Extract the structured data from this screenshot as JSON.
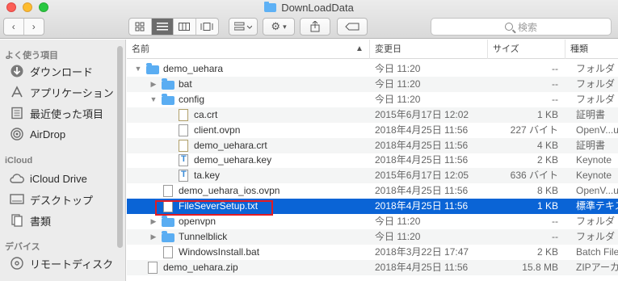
{
  "window": {
    "title": "DownLoadData"
  },
  "toolbar": {
    "back": "‹",
    "forward": "›",
    "search_placeholder": "検索"
  },
  "sidebar": {
    "favorites_header": "よく使う項目",
    "favorites": [
      {
        "label": "ダウンロード",
        "icon": "download-icon"
      },
      {
        "label": "アプリケーション",
        "icon": "applications-icon"
      },
      {
        "label": "最近使った項目",
        "icon": "recents-icon"
      },
      {
        "label": "AirDrop",
        "icon": "airdrop-icon"
      }
    ],
    "icloud_header": "iCloud",
    "icloud": [
      {
        "label": "iCloud Drive",
        "icon": "cloud-icon"
      },
      {
        "label": "デスクトップ",
        "icon": "desktop-icon"
      },
      {
        "label": "書類",
        "icon": "documents-icon"
      }
    ],
    "devices_header": "デバイス",
    "devices": [
      {
        "label": "リモートディスク",
        "icon": "disc-icon"
      }
    ]
  },
  "columns": {
    "name": "名前",
    "date": "変更日",
    "size": "サイズ",
    "kind": "種類"
  },
  "files": [
    {
      "name": "demo_uehara",
      "date": "今日 11:20",
      "size": "--",
      "kind": "フォルダ",
      "type": "folder",
      "level": 0,
      "disclosure": "open"
    },
    {
      "name": "bat",
      "date": "今日 11:20",
      "size": "--",
      "kind": "フォルダ",
      "type": "folder",
      "level": 1,
      "disclosure": "closed"
    },
    {
      "name": "config",
      "date": "今日 11:20",
      "size": "--",
      "kind": "フォルダ",
      "type": "folder",
      "level": 1,
      "disclosure": "open"
    },
    {
      "name": "ca.crt",
      "date": "2015年6月17日 12:02",
      "size": "1 KB",
      "kind": "証明書",
      "type": "cert",
      "level": 2,
      "disclosure": ""
    },
    {
      "name": "client.ovpn",
      "date": "2018年4月25日 11:56",
      "size": "227 バイト",
      "kind": "OpenV...ument",
      "type": "doc",
      "level": 2,
      "disclosure": ""
    },
    {
      "name": "demo_uehara.crt",
      "date": "2018年4月25日 11:56",
      "size": "4 KB",
      "kind": "証明書",
      "type": "cert",
      "level": 2,
      "disclosure": ""
    },
    {
      "name": "demo_uehara.key",
      "date": "2018年4月25日 11:56",
      "size": "2 KB",
      "kind": "Keynote",
      "type": "key",
      "level": 2,
      "disclosure": ""
    },
    {
      "name": "ta.key",
      "date": "2015年6月17日 12:05",
      "size": "636 バイト",
      "kind": "Keynote",
      "type": "key",
      "level": 2,
      "disclosure": ""
    },
    {
      "name": "demo_uehara_ios.ovpn",
      "date": "2018年4月25日 11:56",
      "size": "8 KB",
      "kind": "OpenV...ument",
      "type": "doc",
      "level": 1,
      "disclosure": ""
    },
    {
      "name": "FileSeverSetup.txt",
      "date": "2018年4月25日 11:56",
      "size": "1 KB",
      "kind": "標準テキスト",
      "type": "doc",
      "level": 1,
      "disclosure": "",
      "selected": true
    },
    {
      "name": "openvpn",
      "date": "今日 11:20",
      "size": "--",
      "kind": "フォルダ",
      "type": "folder",
      "level": 1,
      "disclosure": "closed"
    },
    {
      "name": "Tunnelblick",
      "date": "今日 11:20",
      "size": "--",
      "kind": "フォルダ",
      "type": "folder",
      "level": 1,
      "disclosure": "closed"
    },
    {
      "name": "WindowsInstall.bat",
      "date": "2018年3月22日 17:47",
      "size": "2 KB",
      "kind": "Batch File",
      "type": "doc",
      "level": 1,
      "disclosure": ""
    },
    {
      "name": "demo_uehara.zip",
      "date": "2018年4月25日 11:56",
      "size": "15.8 MB",
      "kind": "ZIPアーカイブ",
      "type": "zip",
      "level": 0,
      "disclosure": ""
    }
  ],
  "colors": {
    "selection": "#0a64d6",
    "highlight_box": "#e21b23",
    "folder": "#5aadf2"
  }
}
